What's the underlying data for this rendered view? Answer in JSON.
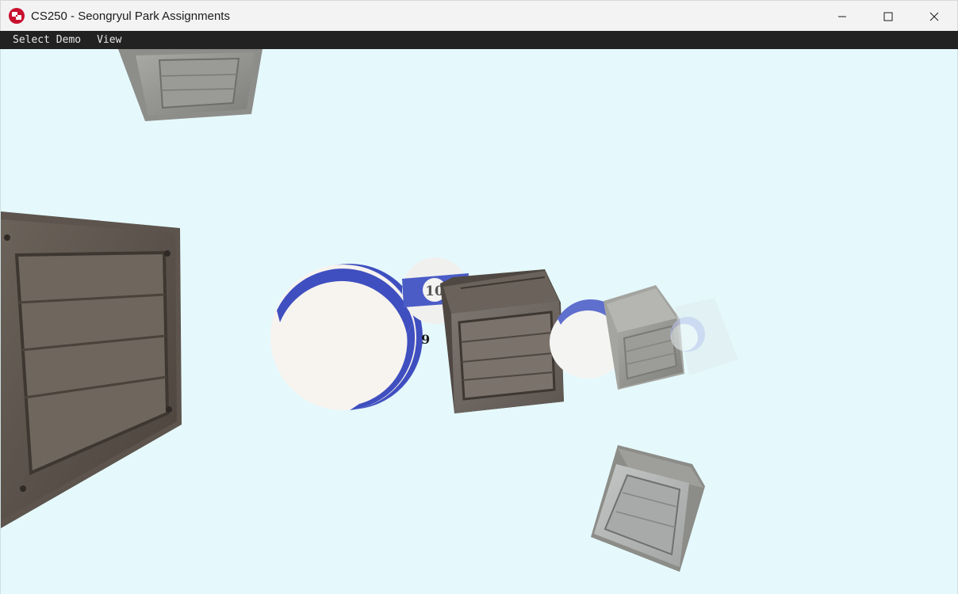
{
  "window": {
    "title": "CS250 - Seongryul Park Assignments",
    "controls": [
      "minimize",
      "maximize",
      "close"
    ]
  },
  "menubar": {
    "items": [
      {
        "label": "Select Demo"
      },
      {
        "label": "View"
      }
    ]
  },
  "scene": {
    "background_color": "#e5f9fc",
    "balls": [
      {
        "number": "10"
      },
      {
        "number": "9"
      }
    ],
    "crate_count": 6,
    "ball_stripe_color": "#3f4fc0"
  }
}
